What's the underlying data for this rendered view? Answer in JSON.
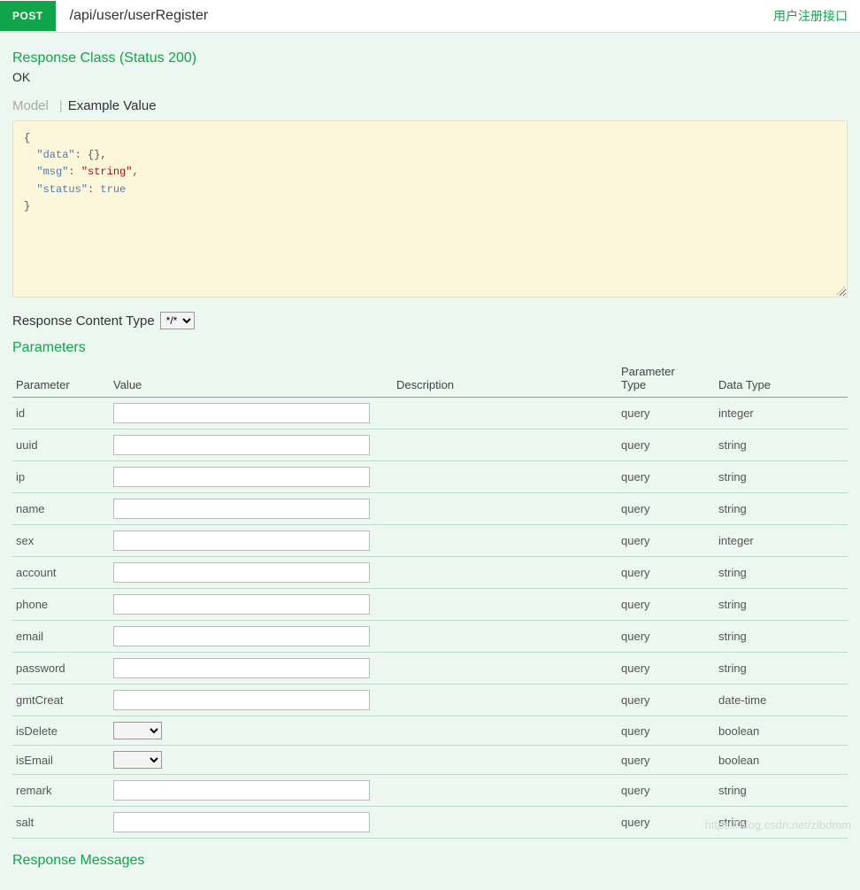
{
  "header": {
    "method": "POST",
    "path": "/api/user/userRegister",
    "desc": "用户注册接口"
  },
  "response": {
    "title": "Response Class (Status 200)",
    "status": "OK",
    "tabs": {
      "model": "Model",
      "example": "Example Value"
    },
    "example_lines": [
      "{",
      "  \"data\": {},",
      "  \"msg\": \"string\",",
      "  \"status\": true",
      "}"
    ]
  },
  "content_type": {
    "label": "Response Content Type",
    "options": [
      "*/*"
    ],
    "selected": "*/*"
  },
  "parameters": {
    "title": "Parameters",
    "headers": {
      "parameter": "Parameter",
      "value": "Value",
      "description": "Description",
      "ptype": "Parameter Type",
      "dtype": "Data Type"
    },
    "rows": [
      {
        "name": "id",
        "input": "text",
        "ptype": "query",
        "dtype": "integer"
      },
      {
        "name": "uuid",
        "input": "text",
        "ptype": "query",
        "dtype": "string"
      },
      {
        "name": "ip",
        "input": "text",
        "ptype": "query",
        "dtype": "string"
      },
      {
        "name": "name",
        "input": "text",
        "ptype": "query",
        "dtype": "string"
      },
      {
        "name": "sex",
        "input": "text",
        "ptype": "query",
        "dtype": "integer"
      },
      {
        "name": "account",
        "input": "text",
        "ptype": "query",
        "dtype": "string"
      },
      {
        "name": "phone",
        "input": "text",
        "ptype": "query",
        "dtype": "string"
      },
      {
        "name": "email",
        "input": "text",
        "ptype": "query",
        "dtype": "string"
      },
      {
        "name": "password",
        "input": "text",
        "ptype": "query",
        "dtype": "string"
      },
      {
        "name": "gmtCreat",
        "input": "text",
        "ptype": "query",
        "dtype": "date-time"
      },
      {
        "name": "isDelete",
        "input": "select",
        "ptype": "query",
        "dtype": "boolean"
      },
      {
        "name": "isEmail",
        "input": "select",
        "ptype": "query",
        "dtype": "boolean"
      },
      {
        "name": "remark",
        "input": "text",
        "ptype": "query",
        "dtype": "string"
      },
      {
        "name": "salt",
        "input": "text",
        "ptype": "query",
        "dtype": "string"
      }
    ]
  },
  "response_messages": {
    "title": "Response Messages"
  },
  "watermark": "https://blog.csdn.net/zlbdmm"
}
